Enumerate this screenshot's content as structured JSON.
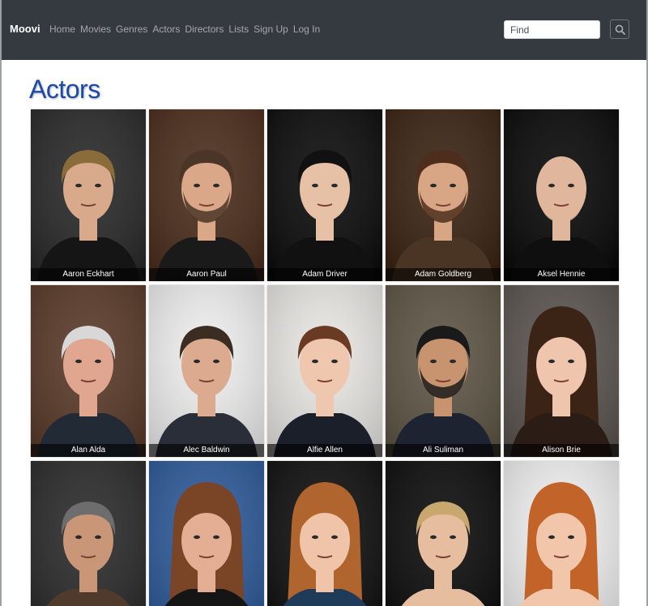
{
  "navbar": {
    "brand": "Moovi",
    "links": [
      "Home",
      "Movies",
      "Genres",
      "Actors",
      "Directors",
      "Lists",
      "Sign Up",
      "Log In"
    ],
    "search": {
      "placeholder": "Find",
      "icon": "search-icon"
    }
  },
  "page": {
    "title": "Actors"
  },
  "actors": [
    {
      "name": "Aaron Eckhart",
      "bg": "#2a2a2a",
      "skin": "#d9a98c",
      "hair": "#8a6b3a",
      "shirt": "#151515",
      "beard": false,
      "bald": false,
      "long": false
    },
    {
      "name": "Aaron Paul",
      "bg": "#4b2e1d",
      "skin": "#dba789",
      "hair": "#4a3526",
      "shirt": "#1a1a1a",
      "beard": true,
      "bald": false,
      "long": false
    },
    {
      "name": "Adam Driver",
      "bg": "#0d0d0d",
      "skin": "#e6c1a6",
      "hair": "#111111",
      "shirt": "#111111",
      "beard": false,
      "bald": false,
      "long": false
    },
    {
      "name": "Adam Goldberg",
      "bg": "#3b2414",
      "skin": "#d8a585",
      "hair": "#4d2e1c",
      "shirt": "#4a3524",
      "beard": true,
      "bald": false,
      "long": false
    },
    {
      "name": "Aksel Hennie",
      "bg": "#0a0a0a",
      "skin": "#e0b79c",
      "hair": "#e0b79c",
      "shirt": "#0f0f0f",
      "beard": true,
      "bald": true,
      "long": false
    },
    {
      "name": "Alan Alda",
      "bg": "#5a3b2a",
      "skin": "#e0a690",
      "hair": "#d8d8d8",
      "shirt": "#222a36",
      "beard": false,
      "bald": false,
      "long": false
    },
    {
      "name": "Alec Baldwin",
      "bg": "#eeeeee",
      "skin": "#dcab8f",
      "hair": "#3b2d22",
      "shirt": "#2a2e38",
      "beard": false,
      "bald": false,
      "long": false
    },
    {
      "name": "Alfie Allen",
      "bg": "#e8e6e3",
      "skin": "#efc7ae",
      "hair": "#6b3a22",
      "shirt": "#1b1f2a",
      "beard": false,
      "bald": false,
      "long": false
    },
    {
      "name": "Ali Suliman",
      "bg": "#5e5646",
      "skin": "#c8936f",
      "hair": "#1a1a1a",
      "shirt": "#1d2330",
      "beard": true,
      "bald": false,
      "long": false
    },
    {
      "name": "Alison Brie",
      "bg": "#5b5550",
      "skin": "#efc6ad",
      "hair": "#3b2416",
      "shirt": "#2b1c15",
      "beard": false,
      "bald": false,
      "long": true
    },
    {
      "name": "",
      "bg": "#2c2c2c",
      "skin": "#c99677",
      "hair": "#6d6d6d",
      "shirt": "#4f3a2c",
      "beard": false,
      "bald": false,
      "long": false
    },
    {
      "name": "",
      "bg": "#2f5b9a",
      "skin": "#e3ae93",
      "hair": "#7a4426",
      "shirt": "#151515",
      "beard": false,
      "bald": false,
      "long": true
    },
    {
      "name": "",
      "bg": "#111111",
      "skin": "#f0c4a8",
      "hair": "#b0642e",
      "shirt": "#1e3c5a",
      "beard": false,
      "bald": false,
      "long": true
    },
    {
      "name": "",
      "bg": "#0e0e0e",
      "skin": "#e7bd9f",
      "hair": "#c9a870",
      "shirt": "#e7bd9f",
      "beard": false,
      "bald": false,
      "long": false
    },
    {
      "name": "",
      "bg": "#efefef",
      "skin": "#f1c6ab",
      "hair": "#c2642a",
      "shirt": "#f1c6ab",
      "beard": false,
      "bald": false,
      "long": true
    }
  ]
}
